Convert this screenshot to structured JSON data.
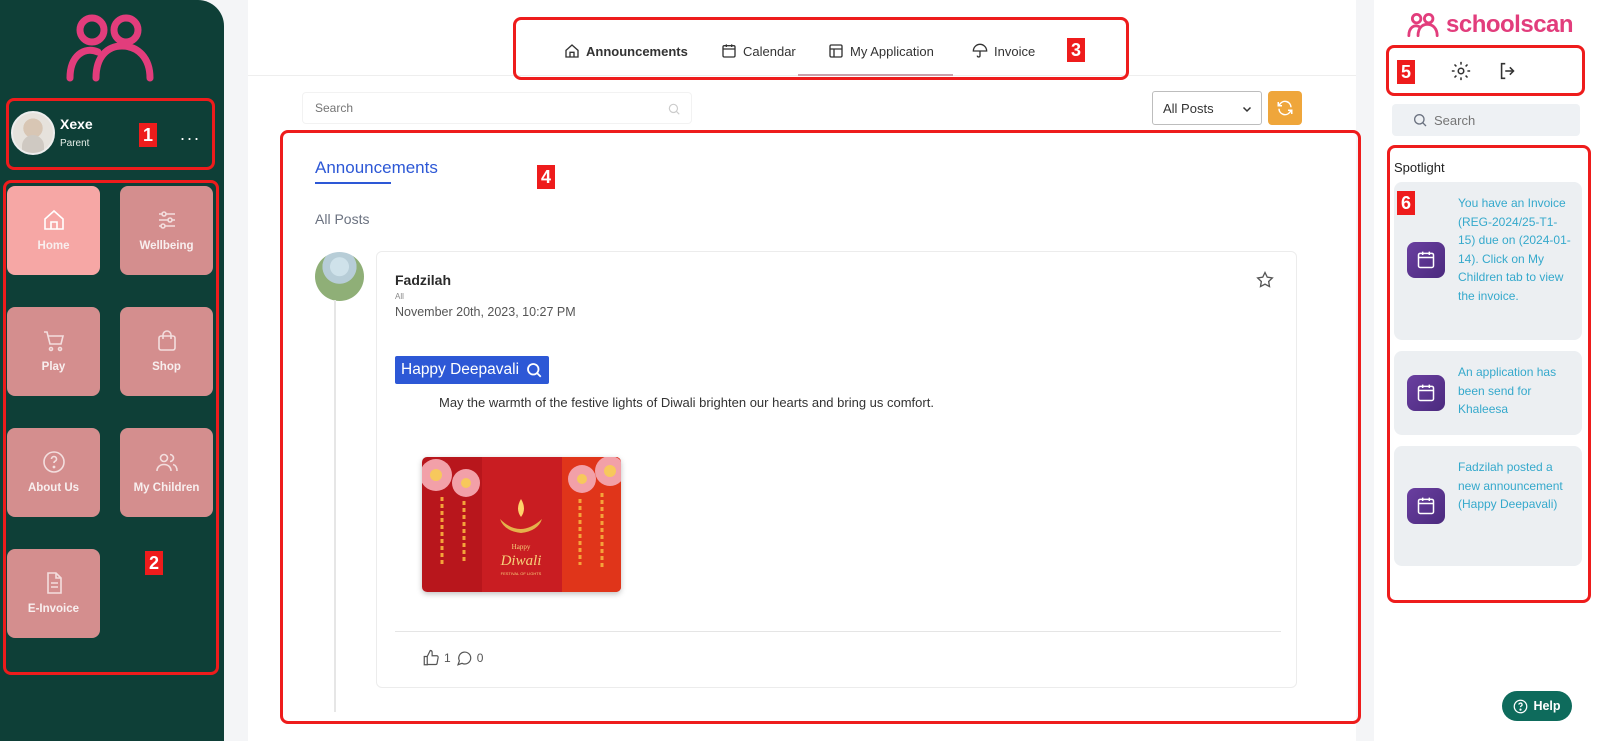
{
  "sidebar": {
    "logo_icon": "people-logo-icon",
    "profile": {
      "name": "Xexe",
      "role": "Parent",
      "more": "..."
    },
    "tiles": [
      {
        "label": "Home",
        "icon": "home-icon",
        "active": true
      },
      {
        "label": "Wellbeing",
        "icon": "sliders-icon",
        "active": false
      },
      {
        "label": "Play",
        "icon": "cart-icon",
        "active": false
      },
      {
        "label": "Shop",
        "icon": "bag-icon",
        "active": false
      },
      {
        "label": "About Us",
        "icon": "question-icon",
        "active": false
      },
      {
        "label": "My Children",
        "icon": "users-icon",
        "active": false
      },
      {
        "label": "E-Invoice",
        "icon": "document-icon",
        "active": false
      }
    ]
  },
  "tabs": [
    {
      "label": "Announcements",
      "icon": "home-icon",
      "active": true
    },
    {
      "label": "Calendar",
      "icon": "calendar-icon",
      "active": false
    },
    {
      "label": "My Application",
      "icon": "layout-icon",
      "active": false
    },
    {
      "label": "Invoice",
      "icon": "umbrella-icon",
      "active": false
    }
  ],
  "filters": {
    "search_placeholder": "Search",
    "select_value": "All Posts"
  },
  "feed": {
    "title": "Announcements",
    "subtitle": "All Posts",
    "post": {
      "author": "Fadzilah",
      "audience": "All",
      "date": "November 20th, 2023, 10:27 PM",
      "tag": "Happy Deepavali",
      "body": "May the warmth of the festive lights of Diwali brighten our hearts and bring us comfort.",
      "image_text_1": "Happy",
      "image_text_2": "Diwali",
      "image_text_3": "FESTIVAL OF LIGHTS",
      "likes": "1",
      "comments": "0"
    }
  },
  "right": {
    "brand": "schoolscan",
    "search_placeholder": "Search",
    "spotlight_title": "Spotlight",
    "notifications": [
      {
        "text": "You have an Invoice (REG-2024/25-T1-15) due on (2024-01-14). Click on My Children tab to view the invoice."
      },
      {
        "text": "An application has been send for Khaleesa"
      },
      {
        "text": "Fadzilah posted a new announcement (Happy Deepavali)"
      }
    ]
  },
  "help": {
    "label": "Help"
  },
  "annotations": [
    "1",
    "2",
    "3",
    "4",
    "5",
    "6"
  ],
  "colors": {
    "sidebar_bg": "#0e3f37",
    "tile": "#d48e8e",
    "tile_active": "#f6a7a5",
    "accent_blue": "#2d58d6",
    "brand_pink": "#e23d7c",
    "refresh_orange": "#efa63b",
    "annotation_red": "#ee1c1c",
    "notification_text": "#35a9cc"
  }
}
